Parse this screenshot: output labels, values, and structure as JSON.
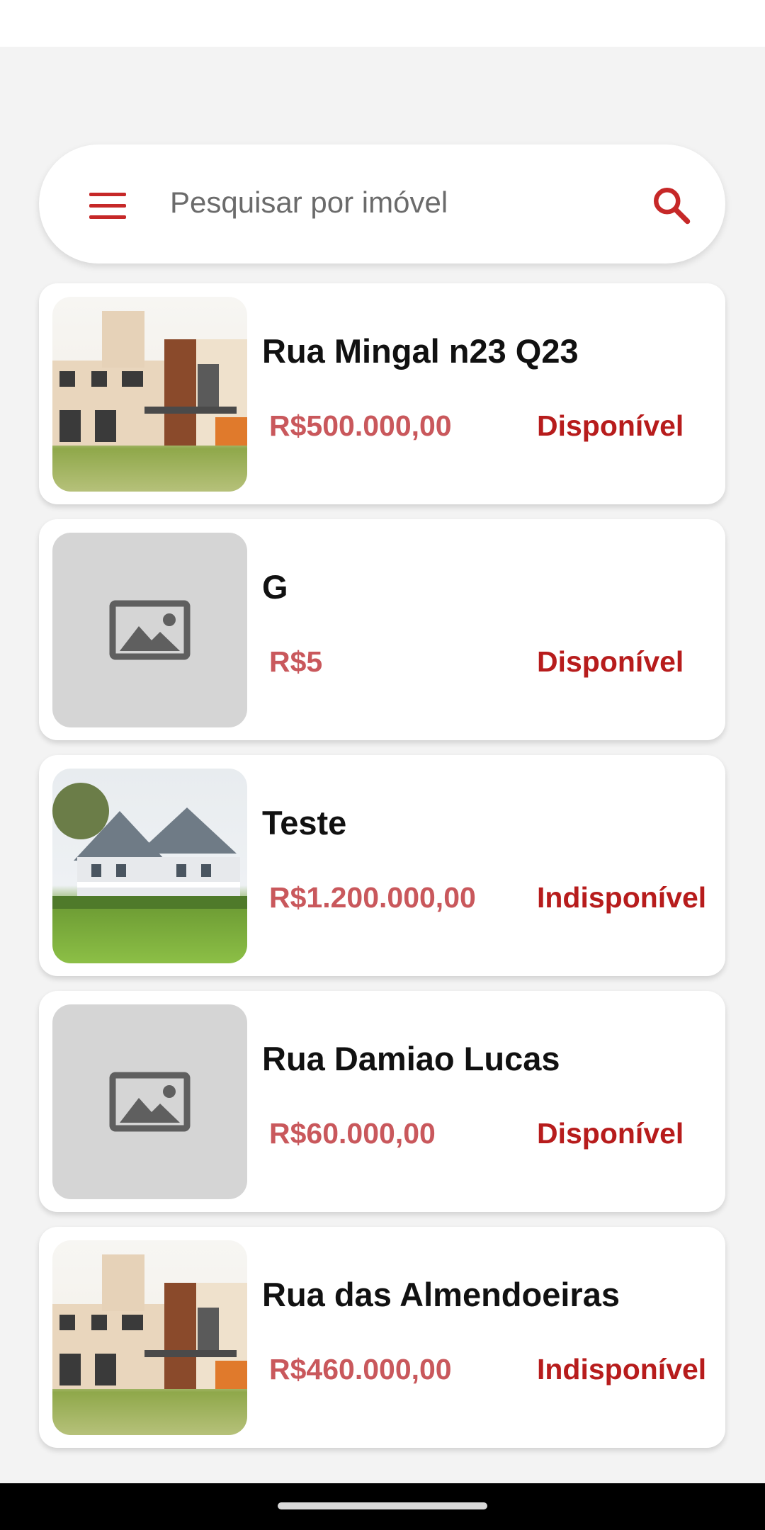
{
  "search": {
    "placeholder": "Pesquisar por imóvel"
  },
  "colors": {
    "accent": "#c62828",
    "price": "#c9585c",
    "status": "#b71c1c",
    "background": "#f3f3f3"
  },
  "listings": [
    {
      "title": "Rua Mingal n23 Q23",
      "price": "R$500.000,00",
      "status": "Disponível",
      "image": "house-photo"
    },
    {
      "title": "G",
      "price": "R$5",
      "status": "Disponível",
      "image": "image-placeholder-icon"
    },
    {
      "title": "Teste",
      "price": "R$1.200.000,00",
      "status": "Indisponível",
      "image": "house-photo"
    },
    {
      "title": "Rua Damiao Lucas",
      "price": "R$60.000,00",
      "status": "Disponível",
      "image": "image-placeholder-icon"
    },
    {
      "title": "Rua das Almendoeiras",
      "price": "R$460.000,00",
      "status": "Indisponível",
      "image": "house-photo"
    }
  ]
}
